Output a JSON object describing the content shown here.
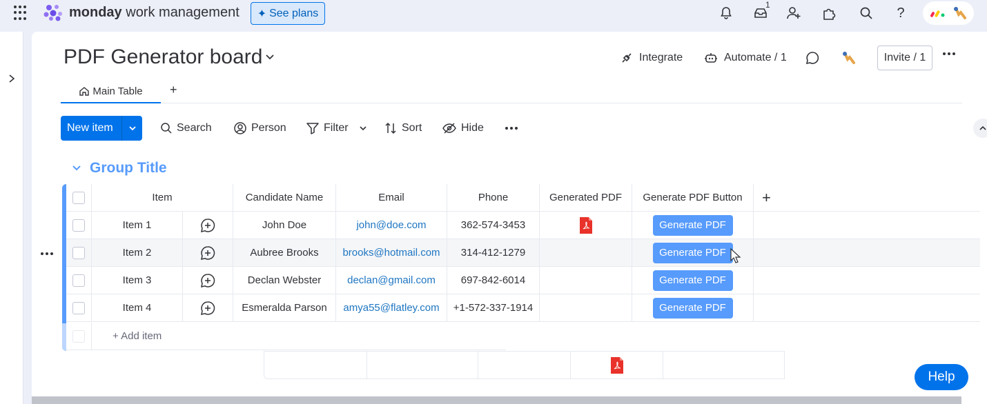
{
  "topbar": {
    "brand_bold": "monday",
    "brand_rest": " work management",
    "see_plans": "See plans",
    "inbox_badge": "1",
    "colors": {
      "accent": "#0073ea",
      "bg": "#eceff8"
    },
    "icons": [
      "apps-grid-icon",
      "bell-icon",
      "inbox-icon",
      "add-user-icon",
      "puzzle-icon",
      "search-icon",
      "help-icon"
    ]
  },
  "board": {
    "title": "PDF Generator board",
    "integrate": "Integrate",
    "automate": "Automate / 1",
    "invite": "Invite / 1"
  },
  "tabs": {
    "main": "Main Table",
    "add": "+"
  },
  "toolbar": {
    "new_item": "New item",
    "search": "Search",
    "person": "Person",
    "filter": "Filter",
    "sort": "Sort",
    "hide": "Hide"
  },
  "group": {
    "title": "Group Title",
    "color": "#579bfc"
  },
  "table": {
    "columns": {
      "item": "Item",
      "candidate": "Candidate Name",
      "email": "Email",
      "phone": "Phone",
      "pdf": "Generated PDF",
      "button": "Generate PDF Button",
      "add": "+"
    },
    "rows": [
      {
        "item": "Item 1",
        "name": "John Doe",
        "email": "john@doe.com",
        "phone": "362-574-3453",
        "has_pdf": true,
        "button": "Generate PDF"
      },
      {
        "item": "Item 2",
        "name": "Aubree Brooks",
        "email": "brooks@hotmail.com",
        "phone": "314-412-1279",
        "has_pdf": false,
        "button": "Generate PDF"
      },
      {
        "item": "Item 3",
        "name": "Declan Webster",
        "email": "declan@gmail.com",
        "phone": "697-842-6014",
        "has_pdf": false,
        "button": "Generate PDF"
      },
      {
        "item": "Item 4",
        "name": "Esmeralda Parson",
        "email": "amya55@flatley.com",
        "phone": "+1-572-337-1914",
        "has_pdf": false,
        "button": "Generate PDF"
      }
    ],
    "add_item": "+ Add item"
  },
  "help": "Help"
}
